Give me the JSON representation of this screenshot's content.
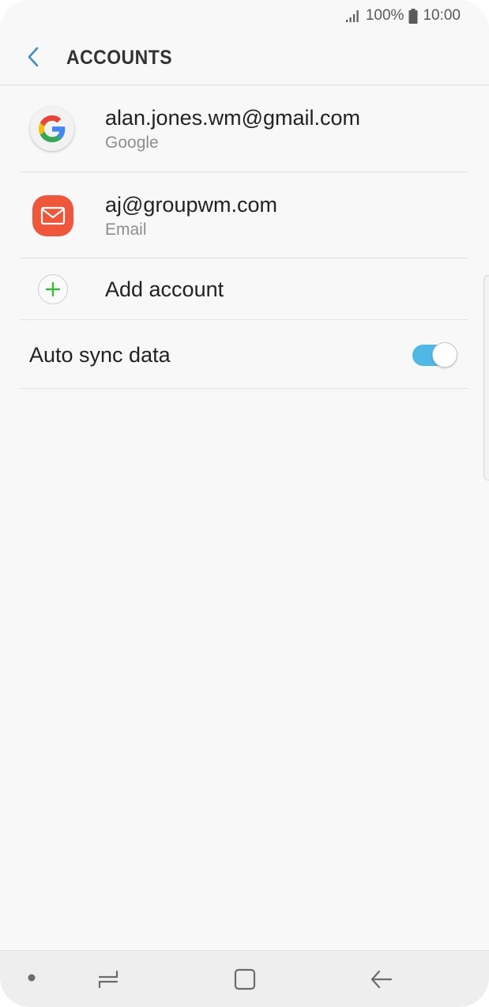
{
  "status_bar": {
    "battery_percent": "100%",
    "time": "10:00"
  },
  "header": {
    "title": "ACCOUNTS"
  },
  "accounts": [
    {
      "name": "alan.jones.wm@gmail.com",
      "type": "Google",
      "icon": "google-icon"
    },
    {
      "name": "aj@groupwm.com",
      "type": "Email",
      "icon": "email-icon"
    }
  ],
  "add_account": {
    "label": "Add account",
    "icon": "plus-icon"
  },
  "auto_sync": {
    "label": "Auto sync data",
    "enabled": true
  },
  "colors": {
    "accent": "#4fb8e6",
    "back_arrow": "#3c8fc4",
    "email_icon_bg": "#f0563a",
    "plus_green": "#3aba3a"
  },
  "nav_bar": {
    "items": [
      "dot",
      "recent-apps",
      "home",
      "back"
    ]
  }
}
